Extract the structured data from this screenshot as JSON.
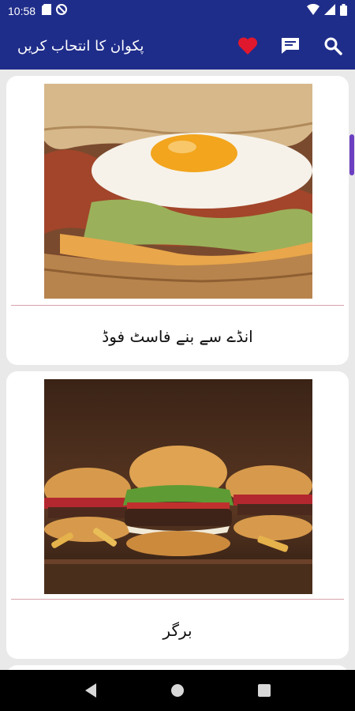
{
  "status_bar": {
    "time": "10:58",
    "icons": [
      "sd-card-icon",
      "no-disturb-icon",
      "wifi-icon",
      "signal-icon",
      "battery-icon"
    ]
  },
  "app_bar": {
    "title": "پکوان کا انتحاب کریں",
    "actions": [
      "favorites-heart-icon",
      "messages-icon",
      "search-icon"
    ]
  },
  "items": [
    {
      "label": "انڈے سے بنے فاسٹ فوڈ",
      "image": "egg-sandwich-image"
    },
    {
      "label": "برگر",
      "image": "burgers-image"
    }
  ],
  "nav_bar": {
    "buttons": [
      "back-icon",
      "home-icon",
      "recents-icon"
    ]
  },
  "colors": {
    "primary": "#1f2d8a",
    "accent_heart": "#e0182d",
    "scroll_thumb": "#6c3fc2",
    "divider": "#d7a3ad"
  }
}
